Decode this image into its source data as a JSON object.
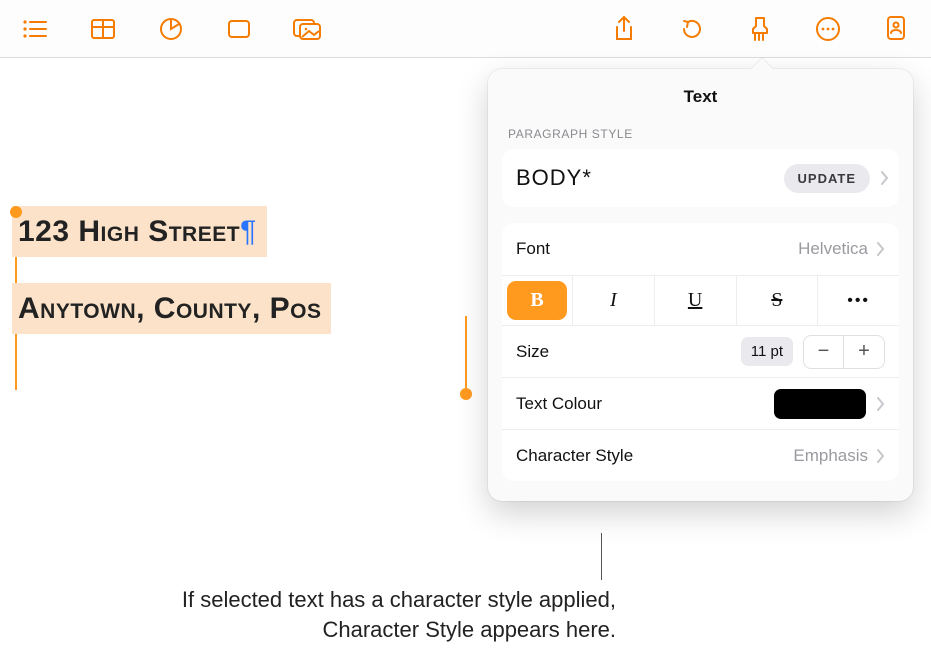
{
  "toolbar": {
    "icons": [
      "list-icon",
      "table-icon",
      "chart-icon",
      "shape-icon",
      "media-icon",
      "share-icon",
      "undo-icon",
      "format-brush-icon",
      "more-icon",
      "collaborate-icon"
    ]
  },
  "document": {
    "line1": "123 High Street",
    "pilcrow": "¶",
    "line2": "Anytown, County, Pos"
  },
  "popover": {
    "title": "Text",
    "section_label": "PARAGRAPH STYLE",
    "paragraph_style": "BODY*",
    "update_label": "UPDATE",
    "font_label": "Font",
    "font_value": "Helvetica",
    "bold": "B",
    "italic": "I",
    "underline": "U",
    "strike": "S",
    "more": "•••",
    "size_label": "Size",
    "size_value": "11 pt",
    "minus": "−",
    "plus": "+",
    "color_label": "Text Colour",
    "charstyle_label": "Character Style",
    "charstyle_value": "Emphasis"
  },
  "callout": "If selected text has a character style applied, Character Style appears here."
}
